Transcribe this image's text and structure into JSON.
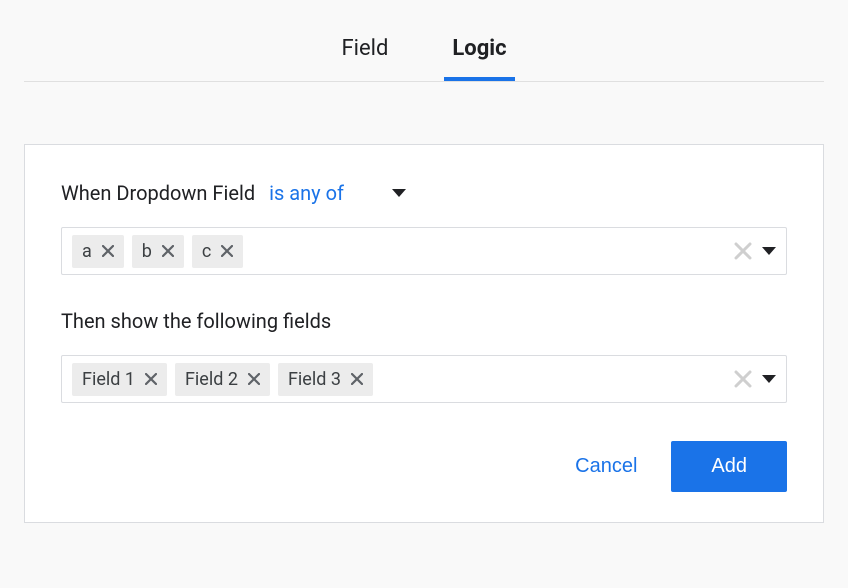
{
  "tabs": {
    "field": "Field",
    "logic": "Logic"
  },
  "condition": {
    "prefix": "When Dropdown Field",
    "operator": "is any of",
    "values": [
      "a",
      "b",
      "c"
    ]
  },
  "then": {
    "label": "Then show the following fields",
    "fields": [
      "Field 1",
      "Field 2",
      "Field 3"
    ]
  },
  "buttons": {
    "cancel": "Cancel",
    "add": "Add"
  }
}
